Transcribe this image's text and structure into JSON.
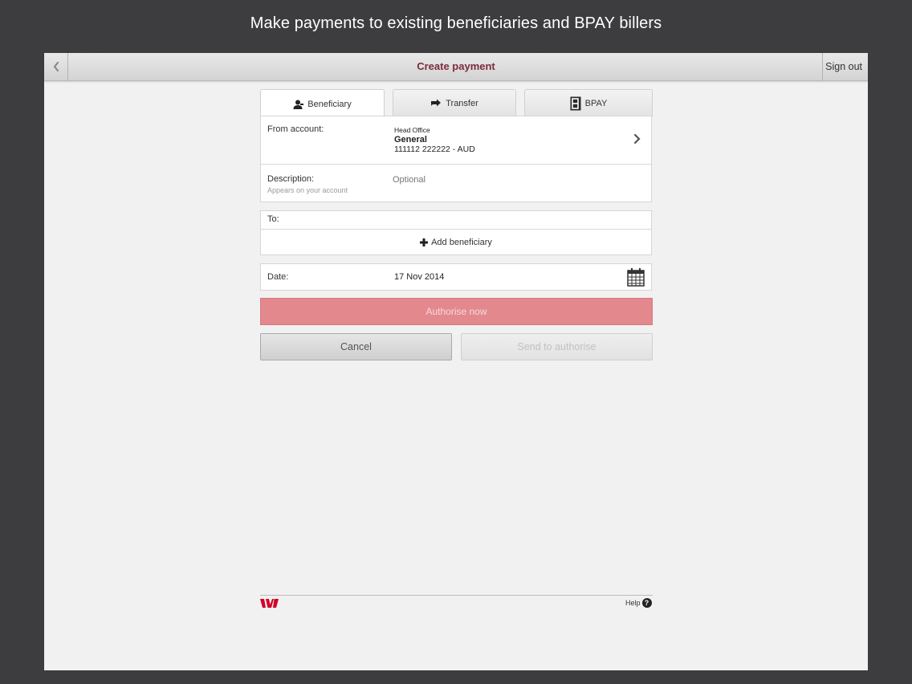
{
  "caption": "Make payments to existing beneficiaries and BPAY billers",
  "navbar": {
    "title": "Create payment",
    "sign_out_label": "Sign out"
  },
  "tabs": [
    {
      "label": "Beneficiary",
      "icon": "person-icon",
      "active": true
    },
    {
      "label": "Transfer",
      "icon": "transfer-arrow-icon",
      "active": false
    },
    {
      "label": "BPAY",
      "icon": "bpay-icon",
      "active": false
    }
  ],
  "from_account": {
    "label": "From account:",
    "branch": "Head Office",
    "name": "General",
    "number": "111112 222222 - AUD"
  },
  "description": {
    "label": "Description:",
    "sublabel": "Appears on your account",
    "placeholder": "Optional"
  },
  "to": {
    "label": "To:",
    "add_label": "Add beneficiary"
  },
  "date": {
    "label": "Date:",
    "value": "17 Nov 2014"
  },
  "buttons": {
    "authorise": "Authorise now",
    "cancel": "Cancel",
    "send": "Send to authorise"
  },
  "footer": {
    "help_label": "Help",
    "help_glyph": "?"
  },
  "colors": {
    "background": "#3d3c3e",
    "title_accent": "#7b2b3c",
    "authorise_disabled": "#e3898e",
    "brand_red": "#d5002b"
  }
}
